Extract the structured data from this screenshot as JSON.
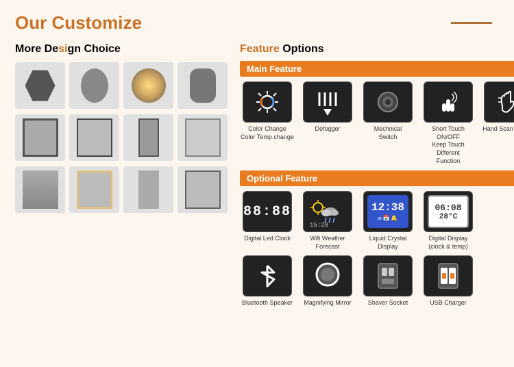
{
  "header": {
    "title_prefix": "Our ",
    "title_highlight": "Customize",
    "line": true
  },
  "left": {
    "section_title_plain": "More De",
    "section_title_highlight": "si",
    "section_title_rest": "gn Choice"
  },
  "right": {
    "section_title_plain": "",
    "section_title_highlight": "Feature",
    "section_title_rest": " Options",
    "main_feature": {
      "header": "Main Feature",
      "icons": [
        {
          "label": "Color Change\nColor Temp.change"
        },
        {
          "label": "Defogger"
        },
        {
          "label": "Mechnical\nSwitch"
        },
        {
          "label": "Short Touch ON/OFF\nKeep Touch Different\nFunction"
        },
        {
          "label": "Hand Scan Sensor"
        }
      ]
    },
    "optional_feature": {
      "header": "Optional Feature",
      "row1": [
        {
          "label": "Digital Led Clock"
        },
        {
          "label": "Wifi Weather Forecast"
        },
        {
          "label": "Liquid Crystal Display"
        },
        {
          "label": "Digital Display\n(clock & temp)"
        }
      ],
      "row2": [
        {
          "label": "Bluetooth Speaker"
        },
        {
          "label": "Magnifying Mirror"
        },
        {
          "label": "Shaver Socket"
        },
        {
          "label": "USB Charger"
        }
      ]
    }
  }
}
